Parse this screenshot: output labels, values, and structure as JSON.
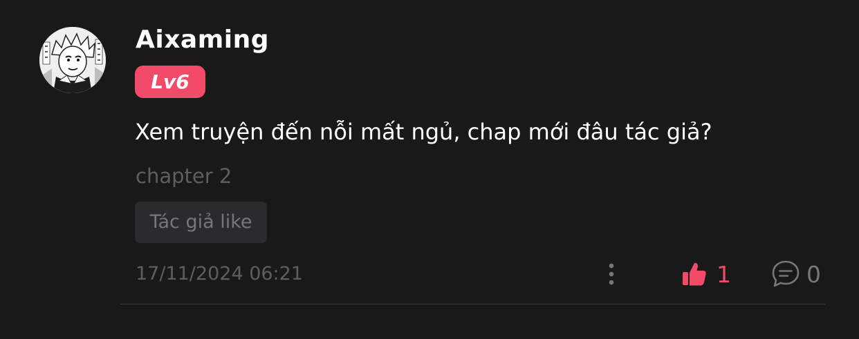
{
  "comment": {
    "username": "Aixaming",
    "level": "Lv6",
    "content": "Xem truyện đến nỗi mất ngủ, chap mới đâu tác giả?",
    "chapter": "chapter 2",
    "author_like_label": "Tác giả like",
    "timestamp": "17/11/2024 06:21",
    "like_count": "1",
    "reply_count": "0"
  },
  "colors": {
    "background": "#1a191a",
    "accent": "#f24b6a",
    "muted_text": "#5e5d60",
    "chip_background": "#2b2a2d"
  },
  "icons": {
    "more": "vertical-ellipsis-icon",
    "like": "thumbs-up-icon",
    "reply": "comment-bubble-icon"
  }
}
